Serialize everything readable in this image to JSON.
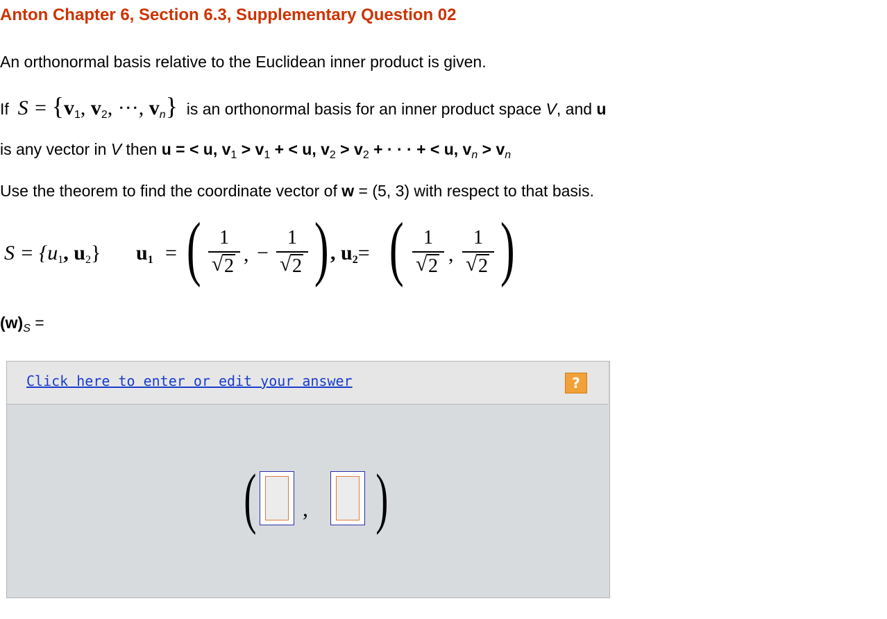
{
  "title": "Anton Chapter 6, Section 6.3, Supplementary Question 02",
  "intro": "An orthonormal basis relative to the Euclidean inner product is given.",
  "theorem": {
    "if": "If",
    "set_lhs": "S =",
    "v1": "v",
    "v2": "v",
    "dots": "···",
    "vn": "v",
    "sub1": "1",
    "sub2": "2",
    "subn": "n",
    "text_a": "is an orthonormal basis for an inner product space",
    "space": "V",
    "text_b": ", and",
    "u": "u",
    "line2_a": "is any vector in",
    "line2_b": "then",
    "formula": "= < u, v",
    "f_mid1": " > v",
    "f_plus1": " + < u, v",
    "f_mid2": " > v",
    "f_plus2": " + · · · + < u, v",
    "f_mid3": " > v"
  },
  "task": {
    "text_a": "Use the theorem to find the coordinate vector of",
    "w": "w",
    "text_b": "= (5, 3) with respect to that basis."
  },
  "basis": {
    "s_eq": "S = {u",
    "sub1": "1",
    "comma": ", u",
    "sub2": "2",
    "close": "}",
    "u1": "u",
    "u1_sub": "1",
    "eq": "=",
    "num": "1",
    "den": "2",
    "minus": "−",
    "comma_sep": ",",
    "u2_label": ", u",
    "u2_sub": "2",
    "u2_eq": "="
  },
  "ws_label": "(w)",
  "ws_sub": "S",
  "ws_eq": "=",
  "answer": {
    "link_text": "Click here to enter or edit your answer",
    "help_label": "?",
    "comma": ","
  }
}
